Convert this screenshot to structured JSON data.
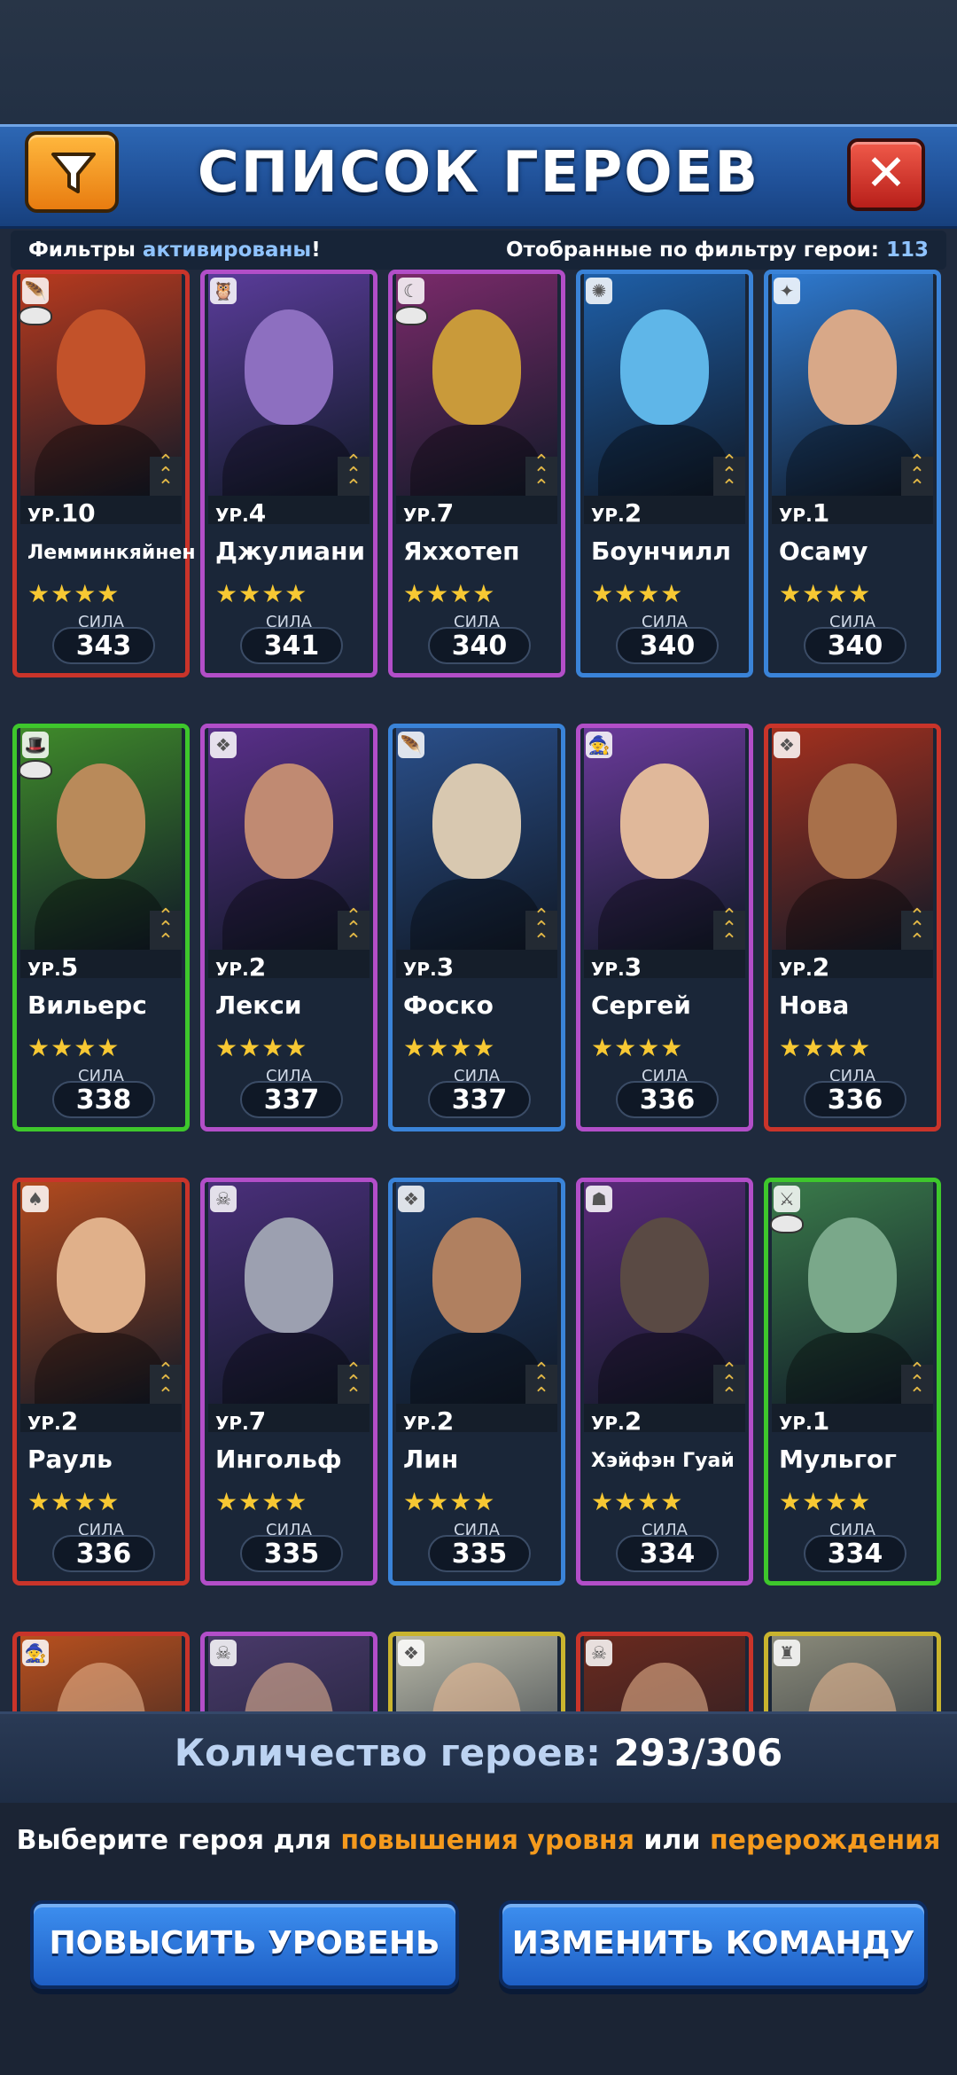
{
  "header": {
    "title": "СПИСОК ГЕРОЕВ",
    "close_symbol": "✕"
  },
  "filter_bar": {
    "left_prefix": "Фильтры ",
    "left_highlight": "активированы",
    "left_suffix": "!",
    "right_label": "Отобранные по фильтру герои: ",
    "right_count": "113"
  },
  "labels": {
    "level_prefix": "УР.",
    "power_label": "СИЛА"
  },
  "heroes": [
    {
      "level": "10",
      "name": "Лемминкяйнен",
      "stars": "★★★★",
      "power": "343",
      "color": "red",
      "portrait": "#c2522a",
      "bg": "#b83a1e",
      "icon": "🪶",
      "mask": true
    },
    {
      "level": "4",
      "name": "Джулиани",
      "stars": "★★★★",
      "power": "341",
      "color": "purple",
      "portrait": "#8d6fc0",
      "bg": "#5a3c9a",
      "icon": "🦉",
      "mask": false
    },
    {
      "level": "7",
      "name": "Яххотеп",
      "stars": "★★★★",
      "power": "340",
      "color": "purple",
      "portrait": "#c99a3a",
      "bg": "#7a2a6a",
      "icon": "☾",
      "mask": true
    },
    {
      "level": "2",
      "name": "Боунчилл",
      "stars": "★★★★",
      "power": "340",
      "color": "blue",
      "portrait": "#5fb6e8",
      "bg": "#1e5fa8",
      "icon": "✺",
      "mask": false
    },
    {
      "level": "1",
      "name": "Осаму",
      "stars": "★★★★",
      "power": "340",
      "color": "blue",
      "portrait": "#d8a888",
      "bg": "#2f7ad0",
      "icon": "✦",
      "mask": false
    },
    {
      "level": "5",
      "name": "Вильерс",
      "stars": "★★★★",
      "power": "338",
      "color": "green",
      "portrait": "#b98a5a",
      "bg": "#3f8a2a",
      "icon": "🎩",
      "mask": true
    },
    {
      "level": "2",
      "name": "Лекси",
      "stars": "★★★★",
      "power": "337",
      "color": "purple",
      "portrait": "#c08a72",
      "bg": "#5a2f8a",
      "icon": "❖",
      "mask": false
    },
    {
      "level": "3",
      "name": "Фоско",
      "stars": "★★★★",
      "power": "337",
      "color": "blue",
      "portrait": "#d8c8b0",
      "bg": "#2a4f8a",
      "icon": "🪶",
      "mask": false
    },
    {
      "level": "3",
      "name": "Сергей",
      "stars": "★★★★",
      "power": "336",
      "color": "purple",
      "portrait": "#e0b89a",
      "bg": "#6a3a9a",
      "icon": "🧙",
      "mask": false
    },
    {
      "level": "2",
      "name": "Нова",
      "stars": "★★★★",
      "power": "336",
      "color": "red",
      "portrait": "#a8704a",
      "bg": "#a3301e",
      "icon": "❖",
      "mask": false
    },
    {
      "level": "2",
      "name": "Рауль",
      "stars": "★★★★",
      "power": "336",
      "color": "red",
      "portrait": "#e0b08a",
      "bg": "#b24a1e",
      "icon": "♠",
      "mask": false
    },
    {
      "level": "7",
      "name": "Ингольф",
      "stars": "★★★★",
      "power": "335",
      "color": "purple",
      "portrait": "#9ca0b0",
      "bg": "#4a2f7a",
      "icon": "☠",
      "mask": false
    },
    {
      "level": "2",
      "name": "Лин",
      "stars": "★★★★",
      "power": "335",
      "color": "blue",
      "portrait": "#b08060",
      "bg": "#22406e",
      "icon": "❖",
      "mask": false
    },
    {
      "level": "2",
      "name": "Хэйфэн Гуай",
      "stars": "★★★★",
      "power": "334",
      "color": "purple",
      "portrait": "#5a4a44",
      "bg": "#5a2a7a",
      "icon": "☗",
      "mask": false
    },
    {
      "level": "1",
      "name": "Мульгог",
      "stars": "★★★★",
      "power": "334",
      "color": "green",
      "portrait": "#7aa88a",
      "bg": "#3a7a4a",
      "icon": "⚔",
      "mask": true
    }
  ],
  "partial_row": [
    {
      "color": "red",
      "bg": "#b8501e",
      "icon": "🧙"
    },
    {
      "color": "purple",
      "bg": "#4a3a6a",
      "icon": "☠"
    },
    {
      "color": "yellow",
      "bg": "#b8b8a8",
      "icon": "❖"
    },
    {
      "color": "red",
      "bg": "#6a2a1e",
      "icon": "☠"
    },
    {
      "color": "yellow",
      "bg": "#8a8a7a",
      "icon": "♜"
    }
  ],
  "footer": {
    "count_label": "Количество героев: ",
    "count_value": "293/306",
    "hint_1": "Выберите героя для ",
    "hint_or1": "повышения уровня",
    "hint_2": " или ",
    "hint_or2": "перерождения",
    "btn_level": "ПОВЫСИТЬ УРОВЕНЬ",
    "btn_team": "ИЗМЕНИТЬ КОМАНДУ"
  }
}
